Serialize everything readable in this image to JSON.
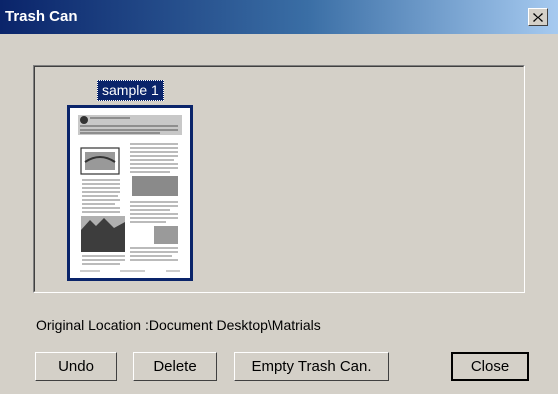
{
  "window": {
    "title": "Trash Can"
  },
  "items": [
    {
      "label": "sample 1"
    }
  ],
  "location": {
    "text": "Original Location :Document Desktop\\Matrials"
  },
  "buttons": {
    "undo": "Undo",
    "delete": "Delete",
    "empty": "Empty Trash Can.",
    "close": "Close"
  },
  "colors": {
    "titlebar_start": "#0a246a",
    "titlebar_end": "#a6caf0",
    "face": "#d4d0c8",
    "selection": "#0a246a"
  },
  "icons": {
    "close": "close-x-icon"
  }
}
